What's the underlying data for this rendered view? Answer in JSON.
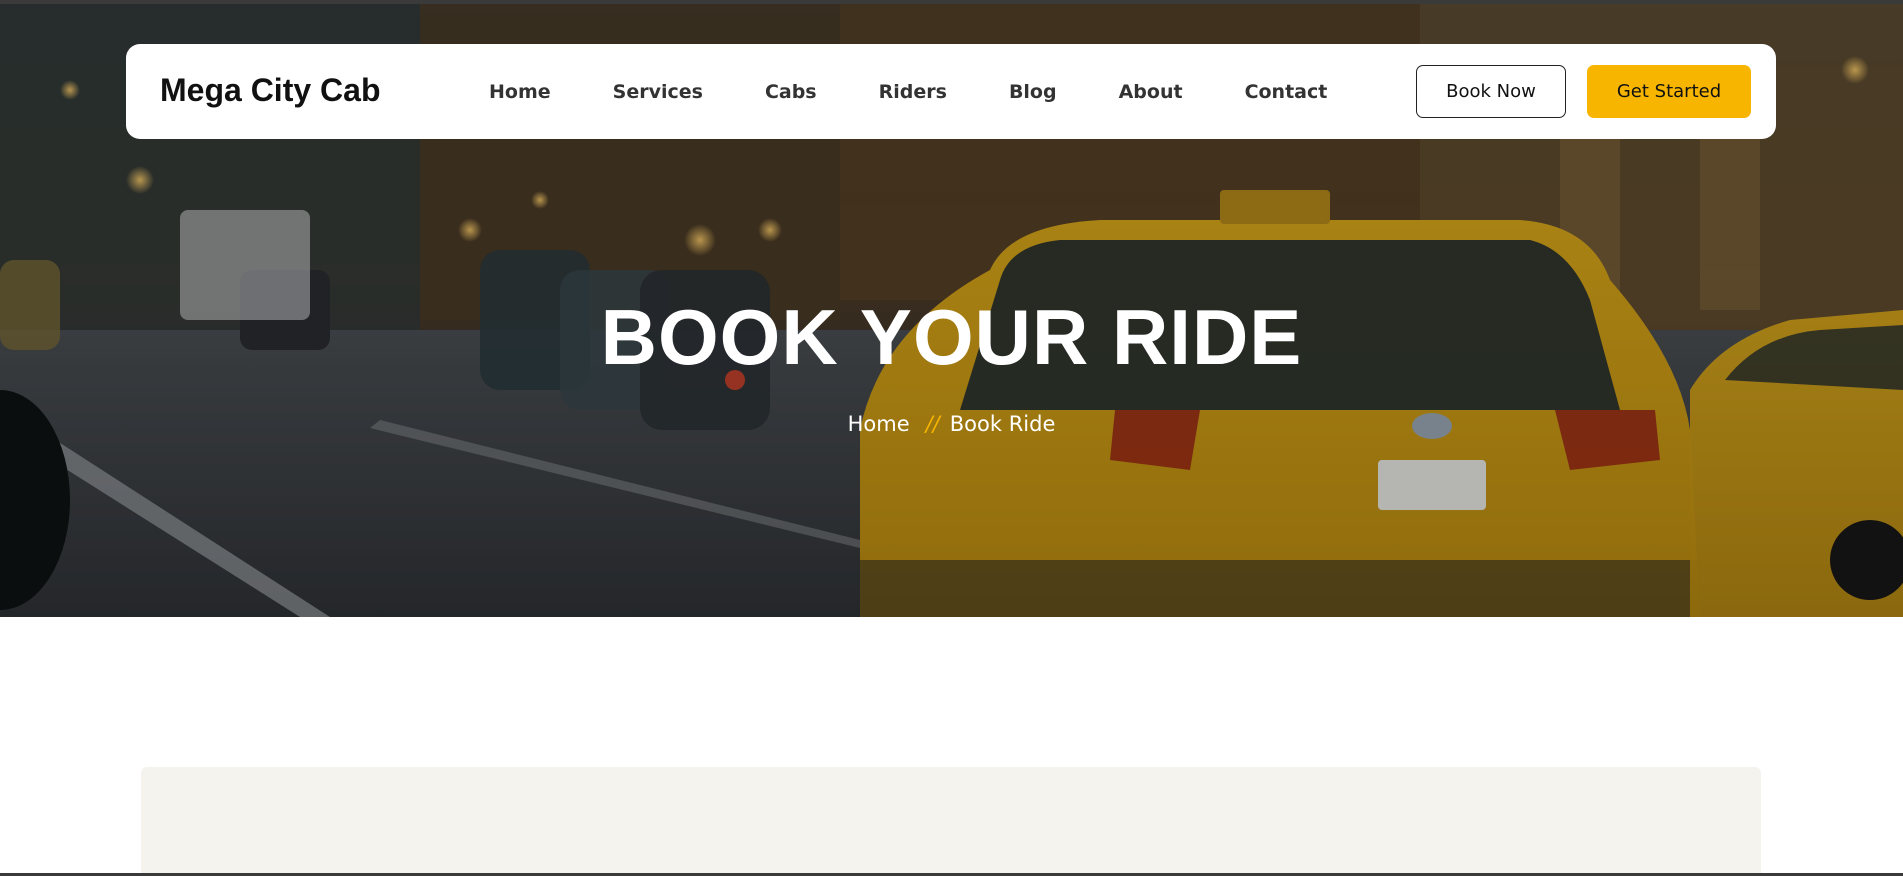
{
  "brand": {
    "name": "Mega City Cab"
  },
  "nav": {
    "links": [
      {
        "label": "Home",
        "icon": ""
      },
      {
        "label": "Services",
        "icon": ""
      },
      {
        "label": "Cabs",
        "icon": ""
      },
      {
        "label": "Riders",
        "icon": ""
      },
      {
        "label": "Blog",
        "icon": ""
      },
      {
        "label": "About",
        "icon": ""
      },
      {
        "label": "Contact",
        "icon": ""
      }
    ],
    "book_now_label": "Book Now",
    "get_started_label": "Get Started"
  },
  "hero": {
    "title": "BOOK YOUR RIDE",
    "breadcrumb": {
      "home": "Home",
      "separator": "//",
      "current": "Book Ride"
    },
    "background_icon": "taxi-street-photo"
  },
  "colors": {
    "accent": "#f7b500",
    "card_background": "#f5f3ee",
    "text_dark": "#111111"
  }
}
